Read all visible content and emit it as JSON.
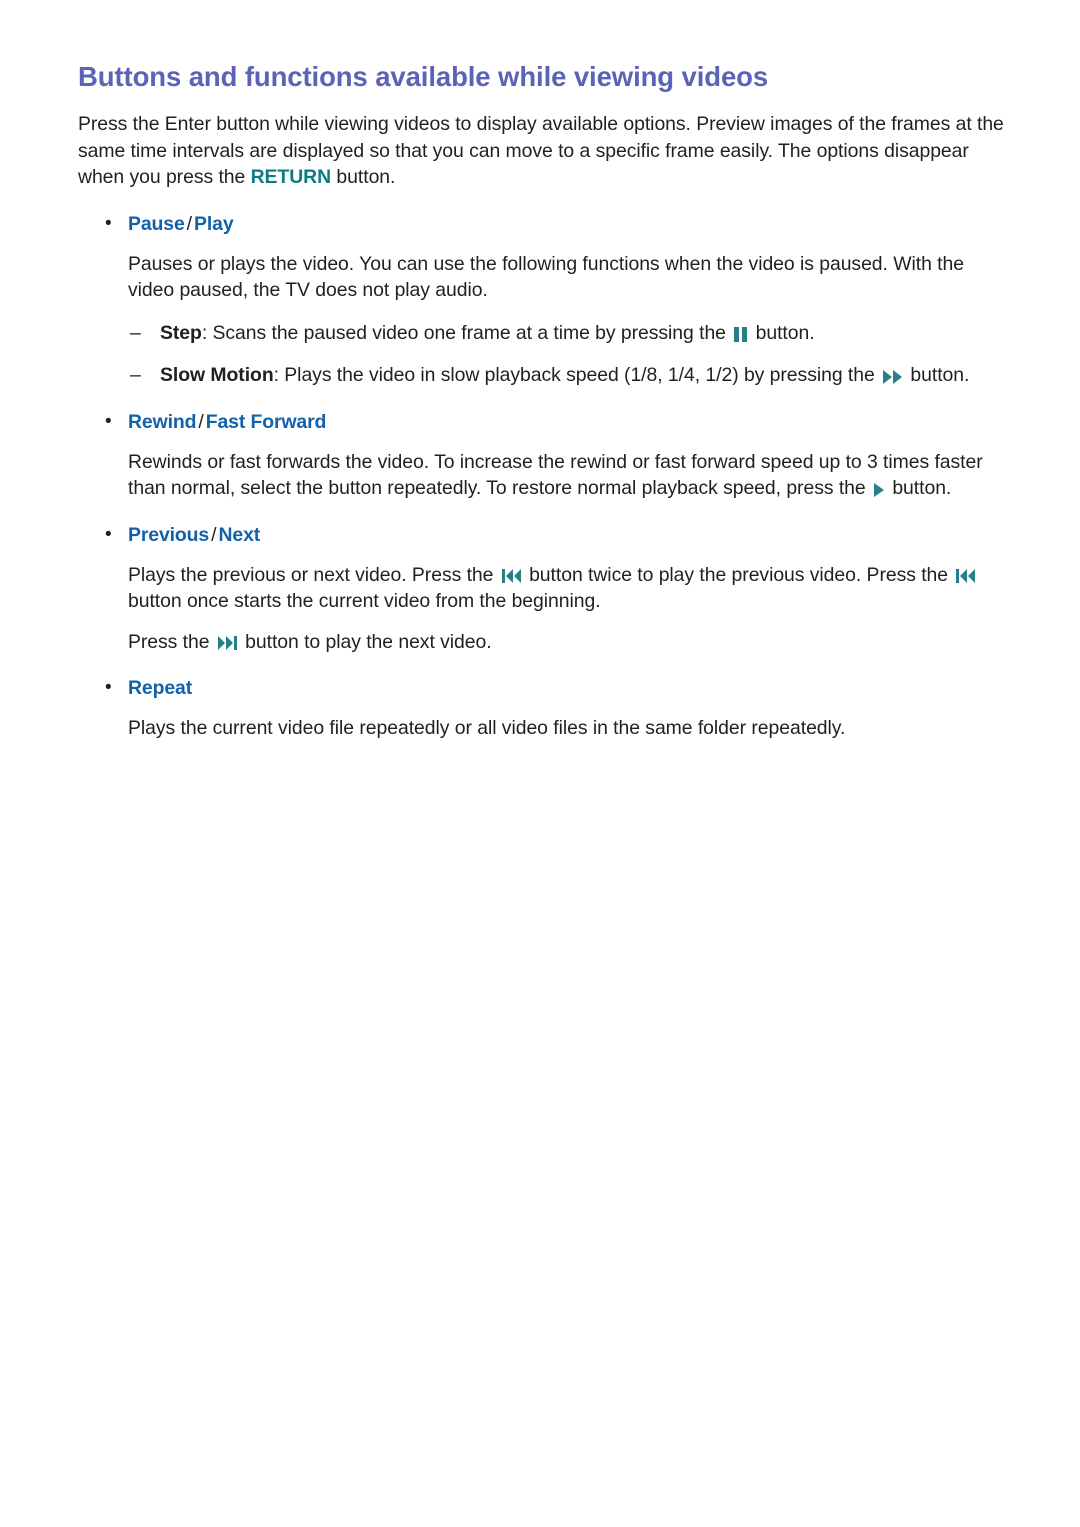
{
  "page": {
    "title": "Buttons and functions available while viewing videos",
    "title_color": "#5b63b7",
    "accent_link_color": "#1162ab",
    "accent_keyword_color": "#0d7b84",
    "icon_color": "#25808a",
    "background": "#ffffff",
    "body_text_color": "#231f20"
  },
  "intro": {
    "part1": "Press the Enter button while viewing videos to display available options. Preview images of the frames at the same time intervals are displayed so that you can move to a specific frame easily. The options disappear when you press the ",
    "keyword": "RETURN",
    "part2": " button."
  },
  "sections": [
    {
      "bullet": "•",
      "title_a": "Pause",
      "separator": "/",
      "title_b": "Play",
      "body": "Pauses or plays the video. You can use the following functions when the video is paused. With the video paused, the TV does not play audio.",
      "sub_items": [
        {
          "dash": "–",
          "label": "Step",
          "text_before": ": Scans the paused video one frame at a time by pressing the ",
          "icon": "pause-icon",
          "text_after": " button."
        },
        {
          "dash": "–",
          "label": "Slow Motion",
          "text_before": ": Plays the video in slow playback speed (1/8, 1/4, 1/2) by pressing the ",
          "icon": "fast-forward-icon",
          "text_after": " button."
        }
      ]
    },
    {
      "bullet": "•",
      "title_a": "Rewind",
      "separator": "/",
      "title_b": "Fast Forward",
      "body_before": "Rewinds or fast forwards the video. To increase the rewind or fast forward speed up to 3 times faster than normal, select the button repeatedly. To restore normal playback speed, press the ",
      "body_icon": "play-icon",
      "body_after": " button."
    },
    {
      "bullet": "•",
      "title_a": "Previous",
      "separator": "/",
      "title_b": "Next",
      "para1_before": "Plays the previous or next video. Press the ",
      "para1_icon1": "previous-icon",
      "para1_middle": " button twice to play the previous video. Press the ",
      "para1_icon2": "previous-icon",
      "para1_after": " button once starts the current video from the beginning.",
      "para2_before": "Press the ",
      "para2_icon": "next-icon",
      "para2_after": " button to play the next video."
    },
    {
      "bullet": "•",
      "title_a": "Repeat",
      "body": "Plays the current video file repeatedly or all video files in the same folder repeatedly."
    }
  ]
}
